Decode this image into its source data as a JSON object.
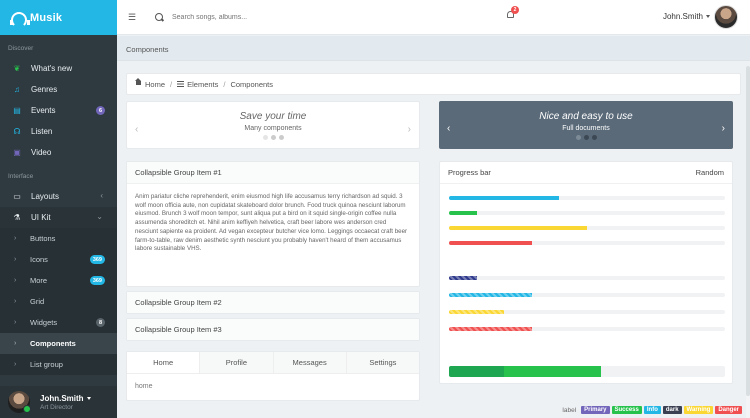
{
  "brand": {
    "name": "Musik",
    "color": "#23b7e5"
  },
  "header": {
    "search_placeholder": "Search songs, albums...",
    "notifications_count": "2",
    "user_name": "John.Smith"
  },
  "sidebar": {
    "section_discover": "Discover",
    "discover_items": [
      {
        "label": "What's new",
        "icon": "leaf-icon",
        "icon_color": "#27c24c"
      },
      {
        "label": "Genres",
        "icon": "music-icon",
        "icon_color": "#23b7e5"
      },
      {
        "label": "Events",
        "icon": "calendar-icon",
        "icon_color": "#23b7e5",
        "badge": "6"
      },
      {
        "label": "Listen",
        "icon": "headphones-icon",
        "icon_color": "#23b7e5"
      },
      {
        "label": "Video",
        "icon": "video-icon",
        "icon_color": "#7266ba"
      }
    ],
    "section_interface": "Interface",
    "interface_items": [
      {
        "label": "Layouts",
        "icon": "desktop-icon"
      },
      {
        "label": "UI Kit",
        "icon": "flask-icon"
      }
    ],
    "uikit_sub": [
      {
        "label": "Buttons"
      },
      {
        "label": "Icons",
        "badge": "369"
      },
      {
        "label": "More",
        "badge": "369"
      },
      {
        "label": "Grid"
      },
      {
        "label": "Widgets",
        "badge": "8"
      },
      {
        "label": "Components",
        "active": true
      },
      {
        "label": "List group"
      }
    ],
    "user": {
      "name": "John.Smith",
      "role": "Art Director"
    }
  },
  "page": {
    "heading": "Components",
    "breadcrumb": {
      "home": "Home",
      "elements": "Elements",
      "current": "Components"
    }
  },
  "carousels": [
    {
      "title": "Save your time",
      "subtitle": "Many components"
    },
    {
      "title": "Nice and easy to use",
      "subtitle": "Full documents"
    }
  ],
  "collapsible": {
    "item1_title": "Collapsible Group Item #1",
    "item1_body": "Anim pariatur cliche reprehenderit, enim eiusmod high life accusamus terry richardson ad squid. 3 wolf moon officia aute, non cupidatat skateboard dolor brunch. Food truck quinoa nesciunt laborum eiusmod. Brunch 3 wolf moon tempor, sunt aliqua put a bird on it squid single-origin coffee nulla assumenda shoreditch et. Nihil anim keffiyeh helvetica, craft beer labore wes anderson cred nesciunt sapiente ea proident. Ad vegan excepteur butcher vice lomo. Leggings occaecat craft beer farm-to-table, raw denim aesthetic synth nesciunt you probably haven't heard of them accusamus labore sustainable VHS.",
    "item2_title": "Collapsible Group Item #2",
    "item3_title": "Collapsible Group Item #3"
  },
  "tabs": {
    "items": [
      "Home",
      "Profile",
      "Messages",
      "Settings"
    ],
    "content": "home"
  },
  "progress": {
    "title": "Progress bar",
    "action": "Random",
    "group1": [
      {
        "value": 40,
        "color": "#23b7e5"
      },
      {
        "value": 10,
        "color": "#27c24c"
      },
      {
        "value": 50,
        "color": "#fad733"
      },
      {
        "value": 30,
        "color": "#f05050"
      }
    ],
    "group2": [
      {
        "value": 10,
        "color": "#2f3a8c",
        "striped": true
      },
      {
        "value": 30,
        "color": "#23b7e5",
        "striped": true
      },
      {
        "value": 20,
        "color": "#fad733",
        "striped": true
      },
      {
        "value": 30,
        "color": "#f05050",
        "striped": true
      }
    ],
    "stacked": [
      {
        "value": 20,
        "color": "#1fa650"
      },
      {
        "value": 35,
        "color": "#27c24c"
      }
    ]
  },
  "labels": {
    "plain": "label",
    "items": [
      {
        "text": "Primary",
        "color": "#7266ba"
      },
      {
        "text": "Success",
        "color": "#27c24c"
      },
      {
        "text": "Info",
        "color": "#23b7e5"
      },
      {
        "text": "dark",
        "color": "#3a3f51"
      },
      {
        "text": "Warning",
        "color": "#fad733"
      },
      {
        "text": "Danger",
        "color": "#f05050"
      }
    ]
  }
}
